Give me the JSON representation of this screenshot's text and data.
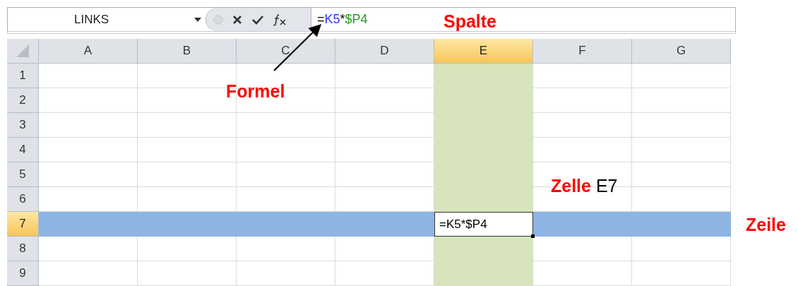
{
  "name_box": {
    "value": "LINKS"
  },
  "formula_bar": {
    "parts": [
      {
        "text": "=",
        "color": "#000000"
      },
      {
        "text": "K5",
        "color": "#3333ff"
      },
      {
        "text": "*",
        "color": "#000000"
      },
      {
        "text": "$P4",
        "color": "#22a022"
      }
    ]
  },
  "columns": [
    {
      "label": "A",
      "selected": false
    },
    {
      "label": "B",
      "selected": false
    },
    {
      "label": "C",
      "selected": false
    },
    {
      "label": "D",
      "selected": false
    },
    {
      "label": "E",
      "selected": true
    },
    {
      "label": "F",
      "selected": false
    },
    {
      "label": "G",
      "selected": false
    }
  ],
  "rows": [
    {
      "label": "1",
      "selected": false
    },
    {
      "label": "2",
      "selected": false
    },
    {
      "label": "3",
      "selected": false
    },
    {
      "label": "4",
      "selected": false
    },
    {
      "label": "5",
      "selected": false
    },
    {
      "label": "6",
      "selected": false
    },
    {
      "label": "7",
      "selected": true
    },
    {
      "label": "8",
      "selected": false
    },
    {
      "label": "9",
      "selected": false
    }
  ],
  "active_cell": {
    "value": "=K5*$P4"
  },
  "annotations": [
    {
      "kind": "column",
      "text": "Spalte"
    },
    {
      "kind": "formula",
      "text": "Formel"
    },
    {
      "kind": "cell",
      "text": "**Zelle** E7"
    },
    {
      "kind": "row",
      "text": "Zeile"
    }
  ]
}
